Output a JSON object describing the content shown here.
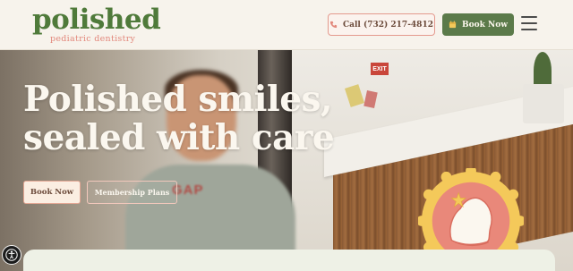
{
  "header": {
    "logo_word": "polished",
    "logo_sub": "pediatric dentistry",
    "call_label": "Call (732) 217-4812",
    "book_label": "Book Now",
    "menu_icon": "hamburger-menu-icon"
  },
  "hero": {
    "title_line1": "Polished smiles,",
    "title_line2": "sealed with care",
    "book_label": "Book Now",
    "membership_label": "Membership Plans",
    "exit_sign": "EXIT",
    "shirt_text": "GAP"
  },
  "colors": {
    "brand_green": "#5b7a4a",
    "brand_coral": "#e2887c",
    "badge_yellow": "#f4c95a",
    "cream": "#fbf7ef"
  },
  "icons": {
    "phone": "phone-icon",
    "calendar": "calendar-icon",
    "accessibility": "accessibility-icon",
    "badge": "tooth-sealant-badge-icon"
  }
}
